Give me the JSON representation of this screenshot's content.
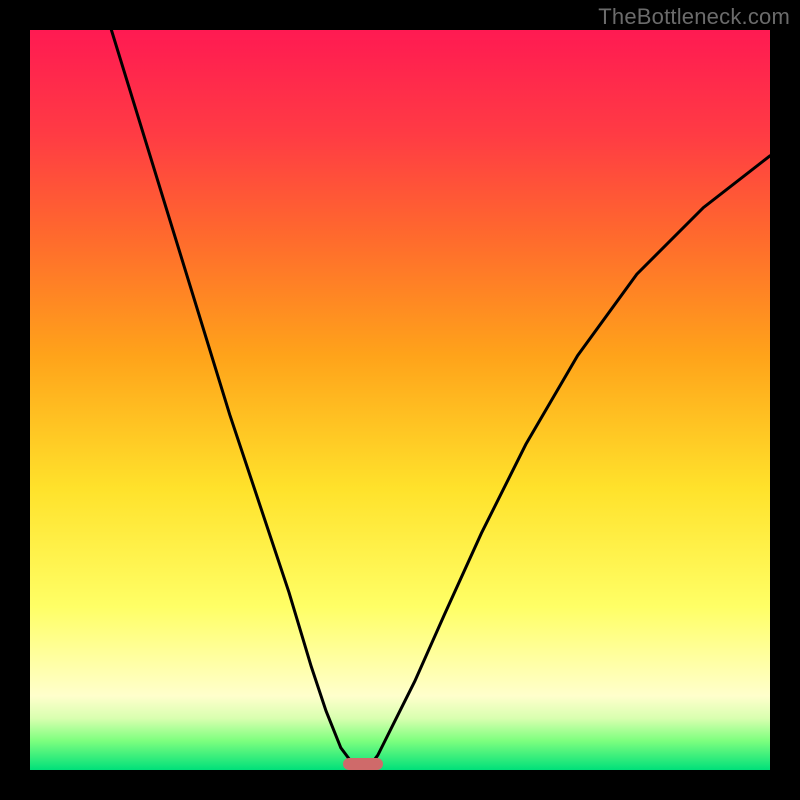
{
  "watermark": "TheBottleneck.com",
  "colors": {
    "frame": "#000000",
    "curve": "#000000",
    "marker": "#cf6a6a"
  },
  "chart_data": {
    "type": "line",
    "title": "",
    "xlabel": "",
    "ylabel": "",
    "xlim": [
      0,
      100
    ],
    "ylim": [
      0,
      100
    ],
    "note": "Two curves descending from top toward a common minimum near x≈44, y≈0; left branch from top-left, right branch from mid-right. Values estimated from pixels (no axis labels present).",
    "series": [
      {
        "name": "left-branch",
        "x": [
          11,
          15,
          19,
          23,
          27,
          31,
          35,
          38,
          40,
          42,
          43.5,
          44.5
        ],
        "y": [
          100,
          87,
          74,
          61,
          48,
          36,
          24,
          14,
          8,
          3,
          1,
          0
        ]
      },
      {
        "name": "right-branch",
        "x": [
          45.5,
          47,
          49,
          52,
          56,
          61,
          67,
          74,
          82,
          91,
          100
        ],
        "y": [
          0,
          2,
          6,
          12,
          21,
          32,
          44,
          56,
          67,
          76,
          83
        ]
      }
    ],
    "marker": {
      "x_center": 45,
      "y": 0,
      "width_pct": 5.5,
      "height_pct": 1.6
    },
    "gradient_stops": [
      {
        "pos": 0,
        "color": "#ff1a52"
      },
      {
        "pos": 14,
        "color": "#ff3b44"
      },
      {
        "pos": 28,
        "color": "#ff6a2d"
      },
      {
        "pos": 44,
        "color": "#ffa31a"
      },
      {
        "pos": 62,
        "color": "#ffe22b"
      },
      {
        "pos": 78,
        "color": "#ffff66"
      },
      {
        "pos": 86,
        "color": "#ffffaa"
      },
      {
        "pos": 90,
        "color": "#ffffcc"
      },
      {
        "pos": 93,
        "color": "#d9ffb0"
      },
      {
        "pos": 96,
        "color": "#7fff7f"
      },
      {
        "pos": 100,
        "color": "#00e07a"
      }
    ]
  }
}
